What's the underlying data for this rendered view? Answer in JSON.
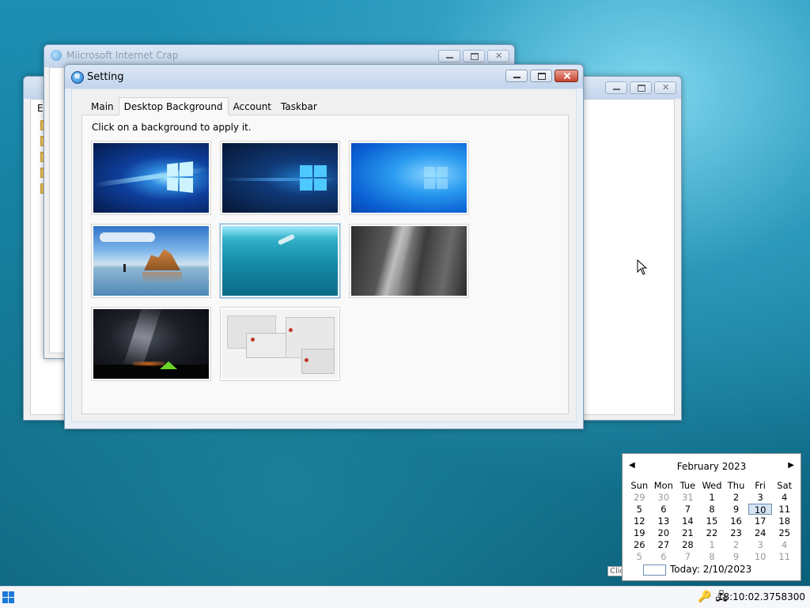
{
  "back_windows": {
    "explorer_title": "E",
    "ie_title": "Miicrosoft Internet Crap"
  },
  "setting_window": {
    "title": "Setting",
    "tabs": [
      {
        "label": "Main",
        "active": false
      },
      {
        "label": "Desktop Background",
        "active": true
      },
      {
        "label": "Account",
        "active": false
      },
      {
        "label": "Taskbar",
        "active": false
      }
    ],
    "hint": "Click on a background to apply it.",
    "backgrounds": [
      {
        "name": "windows-10-hero-light"
      },
      {
        "name": "windows-10-hero-dark"
      },
      {
        "name": "windows-bloom-blue"
      },
      {
        "name": "beach-rocks"
      },
      {
        "name": "underwater-swimmer",
        "selected": true
      },
      {
        "name": "rock-cliff"
      },
      {
        "name": "milky-way-tent"
      },
      {
        "name": "windows-collage"
      }
    ]
  },
  "calendar": {
    "month_label": "February 2023",
    "weekdays": [
      "Sun",
      "Mon",
      "Tue",
      "Wed",
      "Thu",
      "Fri",
      "Sat"
    ],
    "days": [
      [
        "29",
        "30",
        "31",
        "1",
        "2",
        "3",
        "4"
      ],
      [
        "5",
        "6",
        "7",
        "8",
        "9",
        "10",
        "11"
      ],
      [
        "12",
        "13",
        "14",
        "15",
        "16",
        "17",
        "18"
      ],
      [
        "19",
        "20",
        "21",
        "22",
        "23",
        "24",
        "25"
      ],
      [
        "26",
        "27",
        "28",
        "1",
        "2",
        "3",
        "4"
      ],
      [
        "5",
        "6",
        "7",
        "8",
        "9",
        "10",
        "11"
      ]
    ],
    "today_label": "Today: 2/10/2023",
    "selected_day": "10"
  },
  "tooltip_partial": "Clic",
  "taskbar": {
    "clock": "18:10:02.3758300",
    "tray_icons": [
      "keys-icon",
      "network-icon"
    ]
  },
  "colors": {
    "accent": "#1c7ad8",
    "close_red": "#c7432e"
  }
}
